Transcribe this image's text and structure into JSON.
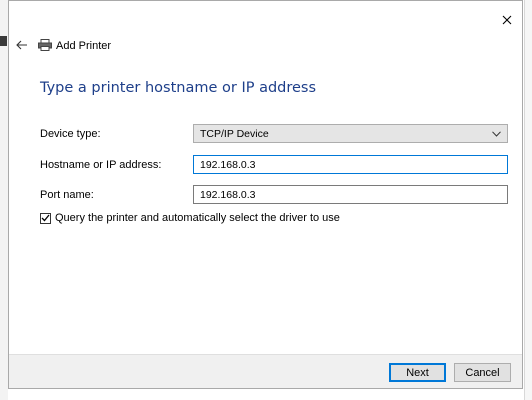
{
  "window": {
    "title": "Add Printer",
    "close_icon": "close-icon",
    "back_icon": "back-arrow-icon",
    "printer_icon": "printer-icon"
  },
  "heading": "Type a printer hostname or IP address",
  "form": {
    "device_type_label": "Device type:",
    "device_type_value": "TCP/IP Device",
    "hostname_label": "Hostname or IP address:",
    "hostname_value": "192.168.0.3",
    "port_label": "Port name:",
    "port_value": "192.168.0.3",
    "query_checkbox_label": "Query the printer and automatically select the driver to use",
    "query_checked": true
  },
  "buttons": {
    "next": "Next",
    "cancel": "Cancel"
  },
  "colors": {
    "heading": "#1e3f8a",
    "accent": "#0078d7",
    "footer": "#f0f0f0"
  }
}
